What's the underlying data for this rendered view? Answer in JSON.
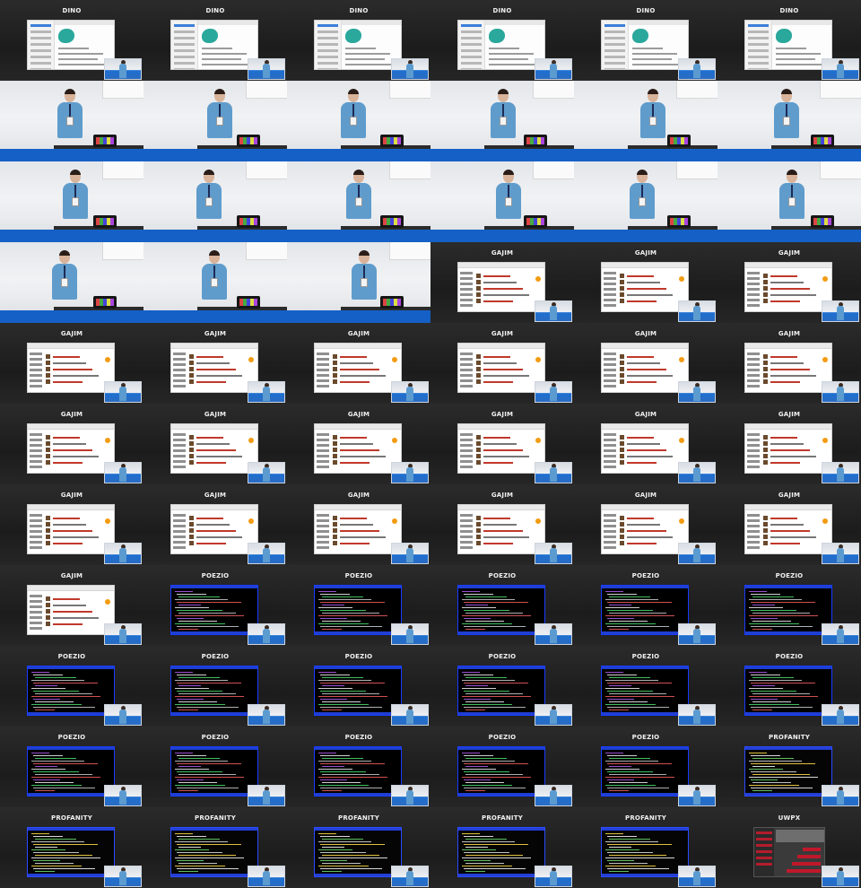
{
  "grid": {
    "columns": 6,
    "rows": 11
  },
  "colors": {
    "slide_background": "#1c1c1c",
    "title_text": "#f0f0f0",
    "dino_accent": "#2aa89c",
    "gajim_accent": "#c0392b",
    "terminal_border": "#1f3fd1",
    "uwpx_accent": "#b51c2c",
    "stage_desk": "#1560c6"
  },
  "tiles": [
    {
      "kind": "slide",
      "app": "dino",
      "title": "DINO"
    },
    {
      "kind": "slide",
      "app": "dino",
      "title": "DINO"
    },
    {
      "kind": "slide",
      "app": "dino",
      "title": "DINO"
    },
    {
      "kind": "slide",
      "app": "dino",
      "title": "DINO"
    },
    {
      "kind": "slide",
      "app": "dino",
      "title": "DINO"
    },
    {
      "kind": "slide",
      "app": "dino",
      "title": "DINO"
    },
    {
      "kind": "camera"
    },
    {
      "kind": "camera"
    },
    {
      "kind": "camera"
    },
    {
      "kind": "camera"
    },
    {
      "kind": "camera"
    },
    {
      "kind": "camera"
    },
    {
      "kind": "camera"
    },
    {
      "kind": "camera"
    },
    {
      "kind": "camera"
    },
    {
      "kind": "camera"
    },
    {
      "kind": "camera"
    },
    {
      "kind": "camera"
    },
    {
      "kind": "camera"
    },
    {
      "kind": "camera"
    },
    {
      "kind": "camera"
    },
    {
      "kind": "slide",
      "app": "gajim",
      "title": "GAJIM"
    },
    {
      "kind": "slide",
      "app": "gajim",
      "title": "GAJIM"
    },
    {
      "kind": "slide",
      "app": "gajim",
      "title": "GAJIM"
    },
    {
      "kind": "slide",
      "app": "gajim",
      "title": "GAJIM"
    },
    {
      "kind": "slide",
      "app": "gajim",
      "title": "GAJIM"
    },
    {
      "kind": "slide",
      "app": "gajim",
      "title": "GAJIM"
    },
    {
      "kind": "slide",
      "app": "gajim",
      "title": "GAJIM"
    },
    {
      "kind": "slide",
      "app": "gajim",
      "title": "GAJIM"
    },
    {
      "kind": "slide",
      "app": "gajim",
      "title": "GAJIM"
    },
    {
      "kind": "slide",
      "app": "gajim",
      "title": "GAJIM"
    },
    {
      "kind": "slide",
      "app": "gajim",
      "title": "GAJIM"
    },
    {
      "kind": "slide",
      "app": "gajim",
      "title": "GAJIM"
    },
    {
      "kind": "slide",
      "app": "gajim",
      "title": "GAJIM"
    },
    {
      "kind": "slide",
      "app": "gajim",
      "title": "GAJIM"
    },
    {
      "kind": "slide",
      "app": "gajim",
      "title": "GAJIM"
    },
    {
      "kind": "slide",
      "app": "gajim",
      "title": "GAJIM"
    },
    {
      "kind": "slide",
      "app": "gajim",
      "title": "GAJIM"
    },
    {
      "kind": "slide",
      "app": "gajim",
      "title": "GAJIM"
    },
    {
      "kind": "slide",
      "app": "gajim",
      "title": "GAJIM"
    },
    {
      "kind": "slide",
      "app": "gajim",
      "title": "GAJIM"
    },
    {
      "kind": "slide",
      "app": "gajim",
      "title": "GAJIM"
    },
    {
      "kind": "slide",
      "app": "gajim",
      "title": "GAJIM"
    },
    {
      "kind": "slide",
      "app": "poezio",
      "title": "POEZIO"
    },
    {
      "kind": "slide",
      "app": "poezio",
      "title": "POEZIO"
    },
    {
      "kind": "slide",
      "app": "poezio",
      "title": "POEZIO"
    },
    {
      "kind": "slide",
      "app": "poezio",
      "title": "POEZIO"
    },
    {
      "kind": "slide",
      "app": "poezio",
      "title": "POEZIO"
    },
    {
      "kind": "slide",
      "app": "poezio",
      "title": "POEZIO"
    },
    {
      "kind": "slide",
      "app": "poezio",
      "title": "POEZIO"
    },
    {
      "kind": "slide",
      "app": "poezio",
      "title": "POEZIO"
    },
    {
      "kind": "slide",
      "app": "poezio",
      "title": "POEZIO"
    },
    {
      "kind": "slide",
      "app": "poezio",
      "title": "POEZIO"
    },
    {
      "kind": "slide",
      "app": "poezio",
      "title": "POEZIO"
    },
    {
      "kind": "slide",
      "app": "poezio",
      "title": "POEZIO"
    },
    {
      "kind": "slide",
      "app": "poezio",
      "title": "POEZIO"
    },
    {
      "kind": "slide",
      "app": "poezio",
      "title": "POEZIO"
    },
    {
      "kind": "slide",
      "app": "poezio",
      "title": "POEZIO"
    },
    {
      "kind": "slide",
      "app": "poezio",
      "title": "POEZIO"
    },
    {
      "kind": "slide",
      "app": "profanity",
      "title": "PROFANITY"
    },
    {
      "kind": "slide",
      "app": "profanity",
      "title": "PROFANITY"
    },
    {
      "kind": "slide",
      "app": "profanity",
      "title": "PROFANITY"
    },
    {
      "kind": "slide",
      "app": "profanity",
      "title": "PROFANITY"
    },
    {
      "kind": "slide",
      "app": "profanity",
      "title": "PROFANITY"
    },
    {
      "kind": "slide",
      "app": "profanity",
      "title": "PROFANITY"
    },
    {
      "kind": "slide",
      "app": "uwpx",
      "title": "UWPX"
    }
  ]
}
